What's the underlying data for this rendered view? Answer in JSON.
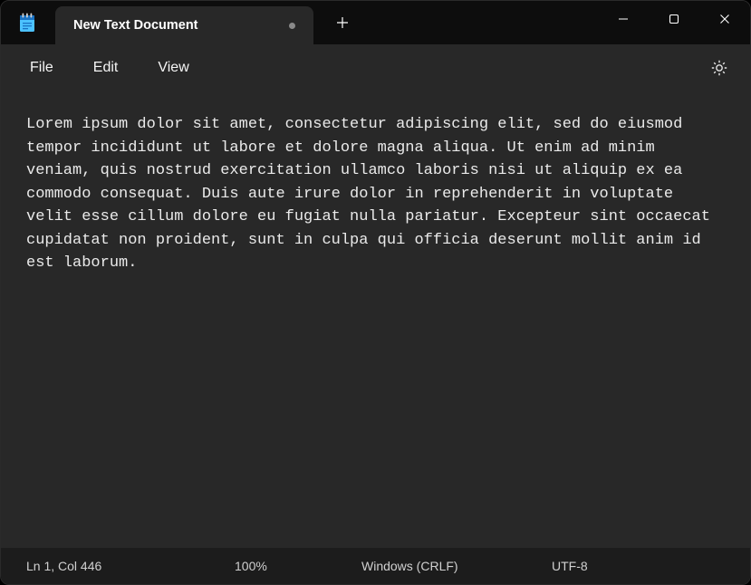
{
  "titlebar": {
    "tab_title": "New Text Document",
    "modified": true
  },
  "menu": {
    "file": "File",
    "edit": "Edit",
    "view": "View"
  },
  "editor": {
    "content": "Lorem ipsum dolor sit amet, consectetur adipiscing elit, sed do eiusmod tempor incididunt ut labore et dolore magna aliqua. Ut enim ad minim veniam, quis nostrud exercitation ullamco laboris nisi ut aliquip ex ea commodo consequat. Duis aute irure dolor in reprehenderit in voluptate velit esse cillum dolore eu fugiat nulla pariatur. Excepteur sint occaecat cupidatat non proident, sunt in culpa qui officia deserunt mollit anim id est laborum."
  },
  "status": {
    "position": "Ln 1, Col 446",
    "zoom": "100%",
    "line_ending": "Windows (CRLF)",
    "encoding": "UTF-8"
  }
}
